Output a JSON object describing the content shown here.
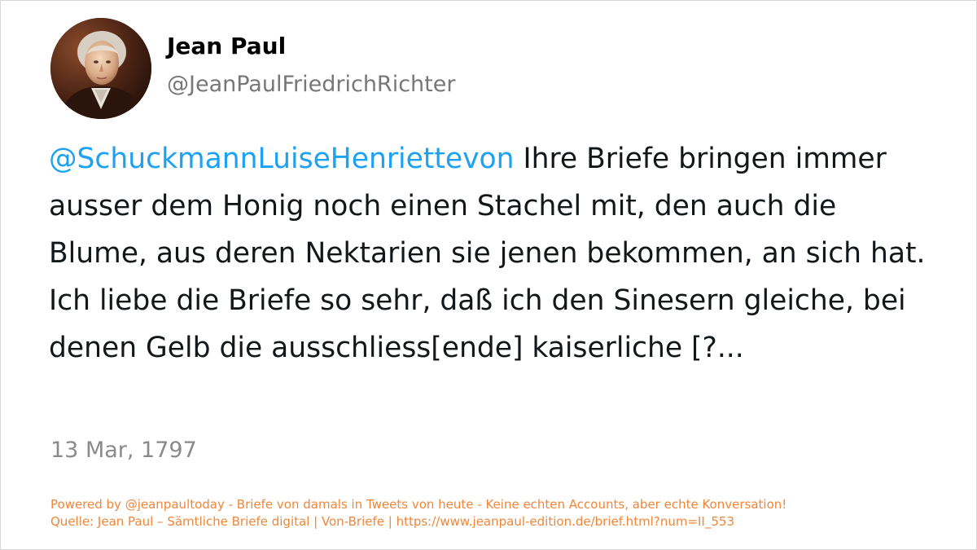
{
  "profile": {
    "display_name": "Jean Paul",
    "handle": "@JeanPaulFriedrichRichter",
    "avatar_icon": "portrait-avatar"
  },
  "tweet": {
    "mention": "@SchuckmannLuiseHenriettevon",
    "text": " Ihre Briefe bringen immer ausser dem Honig noch einen Stachel mit, den auch die Blume, aus deren Nektarien sie jenen bekommen, an sich hat. Ich liebe die Briefe so sehr, daß ich den Sinesern gleiche, bei denen Gelb die ausschliess[ende] kaiserliche [?..."
  },
  "date": "13 Mar, 1797",
  "footer": {
    "line1": "Powered by @jeanpaultoday - Briefe von damals in Tweets von heute - Keine echten Accounts, aber echte Konversation!",
    "line2": "Quelle: Jean Paul – Sämtliche Briefe digital | Von-Briefe | https://www.jeanpaul-edition.de/brief.html?num=II_553"
  },
  "colors": {
    "mention": "#1da1f2",
    "body_text": "#14171a",
    "secondary_text": "#777777",
    "footer_text": "#f0863a",
    "background": "#ffffff"
  }
}
